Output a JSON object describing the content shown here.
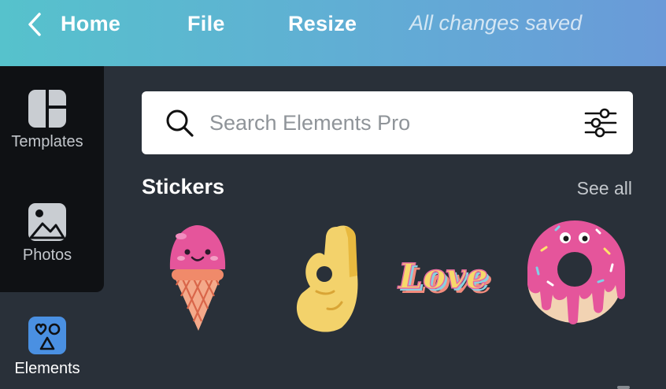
{
  "topbar": {
    "home_label": "Home",
    "file_label": "File",
    "resize_label": "Resize",
    "status_text": "All changes saved"
  },
  "sidebar": {
    "items": [
      {
        "label": "Templates",
        "icon": "templates-icon"
      },
      {
        "label": "Photos",
        "icon": "photos-icon"
      },
      {
        "label": "Elements",
        "icon": "elements-icon",
        "active": true
      }
    ]
  },
  "search": {
    "placeholder": "Search Elements Pro",
    "value": ""
  },
  "stickers_section": {
    "title": "Stickers",
    "see_all_label": "See all",
    "items": [
      "ice-cream-sticker",
      "ok-hand-sticker",
      "love-text-sticker",
      "donut-sticker"
    ]
  },
  "colors": {
    "topbar_gradient_start": "#56c2cc",
    "topbar_gradient_end": "#6a9ad8",
    "panel_bg": "#293039",
    "sidebar_bg": "#0f1114",
    "elements_icon_bg": "#4a90e2"
  }
}
